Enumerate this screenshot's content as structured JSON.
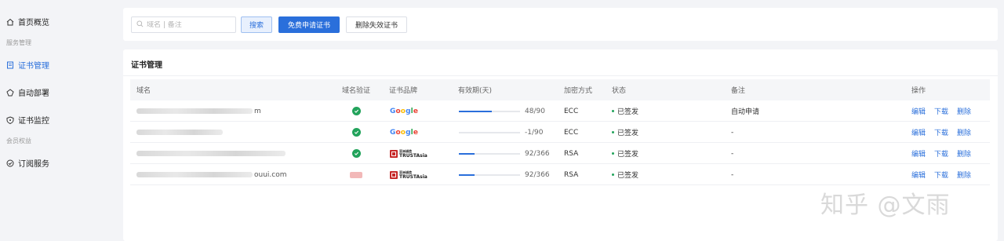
{
  "sidebar": {
    "items": [
      {
        "label": "首页概览",
        "icon": "home-icon"
      },
      {
        "label": "证书管理",
        "icon": "certificate-icon"
      },
      {
        "label": "自动部署",
        "icon": "deploy-icon"
      },
      {
        "label": "证书监控",
        "icon": "shield-icon"
      },
      {
        "label": "订阅服务",
        "icon": "subscription-icon"
      }
    ],
    "groups": [
      "服务管理",
      "会员权益"
    ]
  },
  "toolbar": {
    "search_placeholder": "域名 | 备注",
    "search_label": "搜索",
    "apply_label": "免费申请证书",
    "delete_invalid_label": "删除失效证书"
  },
  "panel": {
    "title": "证书管理"
  },
  "table": {
    "headers": [
      "域名",
      "域名验证",
      "证书品牌",
      "有效期(天)",
      "加密方式",
      "状态",
      "备注",
      "操作"
    ],
    "rows": [
      {
        "domain_suffix": "m",
        "verified": true,
        "brand": "Google",
        "remaining": 48,
        "total": 90,
        "validity_text": "48/90",
        "encryption": "ECC",
        "status": "已签发",
        "remark": "自动申请"
      },
      {
        "domain_suffix": "",
        "verified": true,
        "brand": "Google",
        "remaining": -1,
        "total": 90,
        "validity_text": "-1/90",
        "encryption": "ECC",
        "status": "已签发",
        "remark": "-"
      },
      {
        "domain_suffix": "",
        "verified": true,
        "brand": "TrustAsia",
        "remaining": 92,
        "total": 366,
        "validity_text": "92/366",
        "encryption": "RSA",
        "status": "已签发",
        "remark": "-"
      },
      {
        "domain_suffix": "ouui.com",
        "verified": false,
        "brand": "TrustAsia",
        "remaining": 92,
        "total": 366,
        "validity_text": "92/366",
        "encryption": "RSA",
        "status": "已签发",
        "remark": "-"
      }
    ],
    "actions": [
      "编辑",
      "下载",
      "删除"
    ]
  },
  "brand_logos": {
    "trust_top": "亚洲诚信",
    "trust_bottom": "TRUSTAsia"
  },
  "watermark": "知乎 @文雨",
  "colors": {
    "accent": "#2a6fdb",
    "success": "#22a35b",
    "trust_red": "#c62828"
  }
}
